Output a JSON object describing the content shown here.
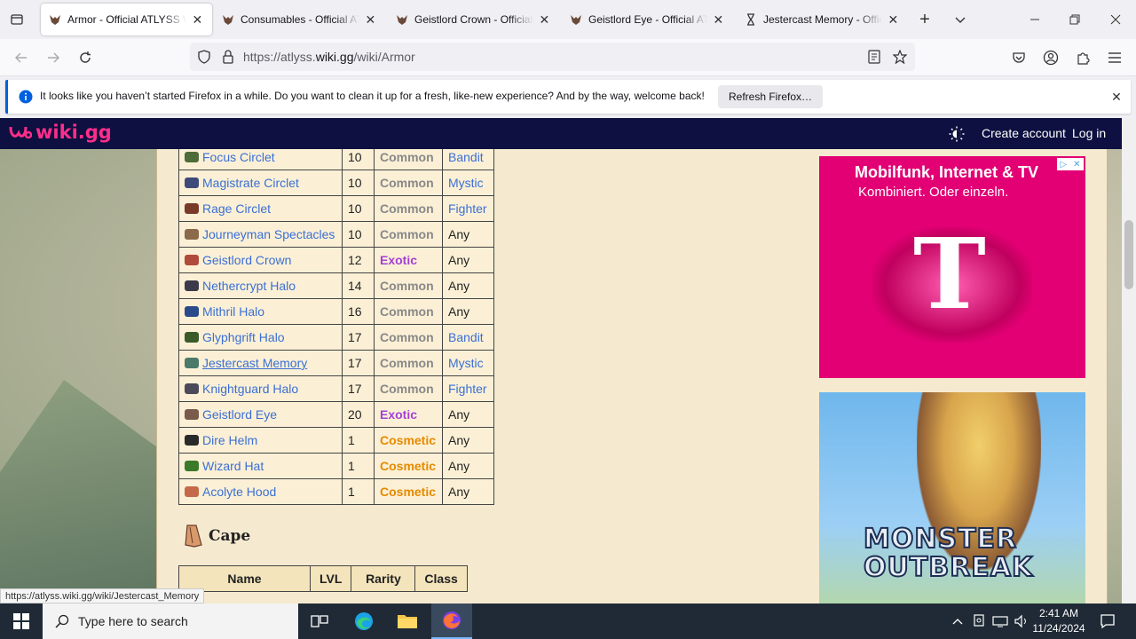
{
  "browser": {
    "tabs": [
      {
        "title": "Armor - Official ATLYSS Wiki",
        "active": true
      },
      {
        "title": "Consumables - Official ATLYSS Wiki",
        "active": false
      },
      {
        "title": "Geistlord Crown - Official ATLYSS Wiki",
        "active": false
      },
      {
        "title": "Geistlord Eye - Official ATLYSS Wiki",
        "active": false
      },
      {
        "title": "Jestercast Memory - Official ATLYSS Wiki",
        "active": false
      }
    ],
    "url_prefix": "https://atlyss.",
    "url_domain": "wiki.gg",
    "url_path": "/wiki/Armor"
  },
  "notification": {
    "message": "It looks like you haven’t started Firefox in a while. Do you want to clean it up for a fresh, like-new experience? And by the way, welcome back!",
    "button": "Refresh Firefox…"
  },
  "wikibar": {
    "logo": "wiki.gg",
    "create_account": "Create account",
    "login": "Log in"
  },
  "armor_rows": [
    {
      "name": "Focus Circlet",
      "lvl": "10",
      "rarity": "Common",
      "class": "Bandit",
      "class_link": true,
      "icon_color": "#4e6b3a"
    },
    {
      "name": "Magistrate Circlet",
      "lvl": "10",
      "rarity": "Common",
      "class": "Mystic",
      "class_link": true,
      "icon_color": "#3e4a7a"
    },
    {
      "name": "Rage Circlet",
      "lvl": "10",
      "rarity": "Common",
      "class": "Fighter",
      "class_link": true,
      "icon_color": "#7a3a2a"
    },
    {
      "name": "Journeyman Spectacles",
      "lvl": "10",
      "rarity": "Common",
      "class": "Any",
      "class_link": false,
      "icon_color": "#8a6a4a"
    },
    {
      "name": "Geistlord Crown",
      "lvl": "12",
      "rarity": "Exotic",
      "class": "Any",
      "class_link": false,
      "icon_color": "#b04a3a"
    },
    {
      "name": "Nethercrypt Halo",
      "lvl": "14",
      "rarity": "Common",
      "class": "Any",
      "class_link": false,
      "icon_color": "#3a3a4a"
    },
    {
      "name": "Mithril Halo",
      "lvl": "16",
      "rarity": "Common",
      "class": "Any",
      "class_link": false,
      "icon_color": "#2a4a8a"
    },
    {
      "name": "Glyphgrift Halo",
      "lvl": "17",
      "rarity": "Common",
      "class": "Bandit",
      "class_link": true,
      "icon_color": "#3a5a2a"
    },
    {
      "name": "Jestercast Memory",
      "lvl": "17",
      "rarity": "Common",
      "class": "Mystic",
      "class_link": true,
      "icon_color": "#4a7a6a"
    },
    {
      "name": "Knightguard Halo",
      "lvl": "17",
      "rarity": "Common",
      "class": "Fighter",
      "class_link": true,
      "icon_color": "#4a4a5a"
    },
    {
      "name": "Geistlord Eye",
      "lvl": "20",
      "rarity": "Exotic",
      "class": "Any",
      "class_link": false,
      "icon_color": "#7a5a4a"
    },
    {
      "name": "Dire Helm",
      "lvl": "1",
      "rarity": "Cosmetic",
      "class": "Any",
      "class_link": false,
      "icon_color": "#2a2a2a"
    },
    {
      "name": "Wizard Hat",
      "lvl": "1",
      "rarity": "Cosmetic",
      "class": "Any",
      "class_link": false,
      "icon_color": "#3a7a2a"
    },
    {
      "name": "Acolyte Hood",
      "lvl": "1",
      "rarity": "Cosmetic",
      "class": "Any",
      "class_link": false,
      "icon_color": "#c46a4a"
    }
  ],
  "cape_section": {
    "heading": "Cape",
    "headers": [
      "Name",
      "LVL",
      "Rarity",
      "Class"
    ]
  },
  "ads": {
    "telekom_headline": "Mobilfunk, Internet & TV",
    "telekom_sub": "Kombiniert. Oder einzeln.",
    "telekom_logo": "T",
    "game_title_1": "MONSTER",
    "game_title_2": "OUTBREAK"
  },
  "status_link": "https://atlyss.wiki.gg/wiki/Jestercast_Memory",
  "taskbar": {
    "search_placeholder": "Type here to search",
    "time": "2:41 AM",
    "date": "11/24/2024"
  },
  "colors": {
    "wikibar_bg": "#0d1040",
    "logo_pink": "#ff2d8a",
    "exotic": "#a63fd6",
    "cosmetic": "#e68a00",
    "common": "#888888",
    "telekom_magenta": "#e20074"
  }
}
